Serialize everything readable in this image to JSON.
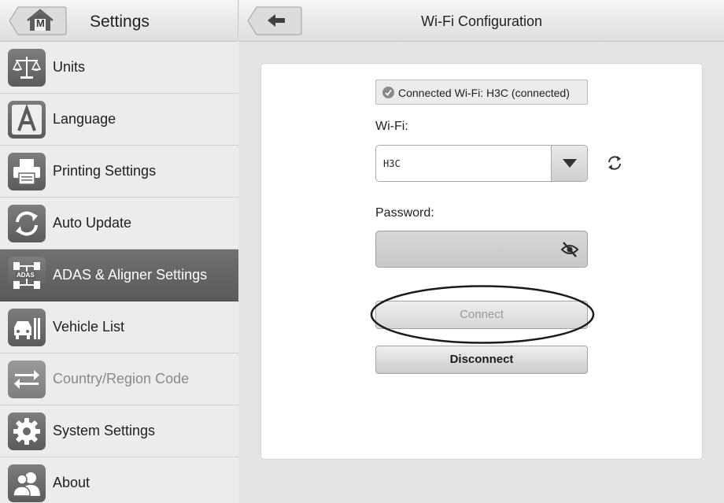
{
  "left_panel": {
    "title": "Settings",
    "home_icon_letter": "M",
    "items": [
      {
        "label": "Units",
        "icon": "scale-icon",
        "state": "normal"
      },
      {
        "label": "Language",
        "icon": "letter-a-icon",
        "state": "normal"
      },
      {
        "label": "Printing Settings",
        "icon": "printer-icon",
        "state": "normal"
      },
      {
        "label": "Auto Update",
        "icon": "refresh-arrows-icon",
        "state": "normal"
      },
      {
        "label": "ADAS & Aligner Settings",
        "icon": "adas-icon",
        "icon_text": "ADAS",
        "state": "active"
      },
      {
        "label": "Vehicle List",
        "icon": "vehicle-list-icon",
        "state": "normal"
      },
      {
        "label": "Country/Region Code",
        "icon": "swap-arrows-icon",
        "state": "disabled"
      },
      {
        "label": "System Settings",
        "icon": "gear-icon",
        "state": "normal"
      },
      {
        "label": "About",
        "icon": "users-icon",
        "state": "normal"
      }
    ]
  },
  "right_panel": {
    "title": "Wi-Fi Configuration",
    "status_text": "Connected Wi-Fi: H3C (connected)",
    "wifi_label": "Wi-Fi:",
    "wifi_selected": "H3C",
    "password_label": "Password:",
    "password_value": "",
    "connect_label": "Connect",
    "disconnect_label": "Disconnect"
  },
  "colors": {
    "active_item": "#616161",
    "icon_tile": "#6a6a6a",
    "card_background": "#ffffff"
  }
}
